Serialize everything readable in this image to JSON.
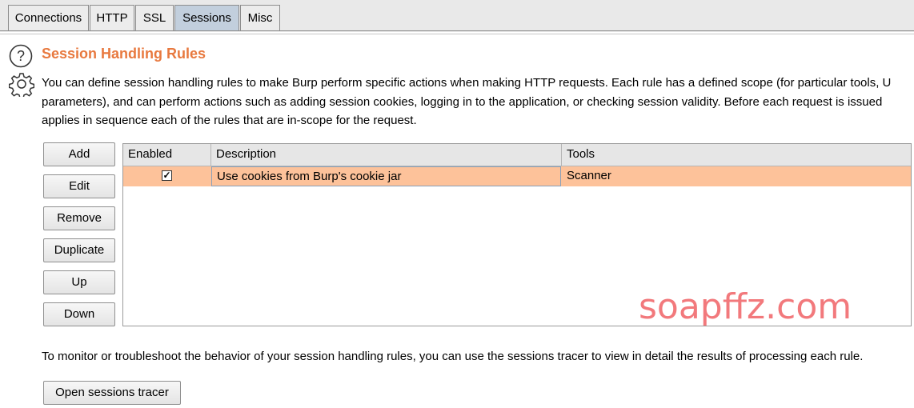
{
  "tabs": [
    {
      "label": "Connections",
      "active": false
    },
    {
      "label": "HTTP",
      "active": false
    },
    {
      "label": "SSL",
      "active": false
    },
    {
      "label": "Sessions",
      "active": true
    },
    {
      "label": "Misc",
      "active": false
    }
  ],
  "section": {
    "title": "Session Handling Rules",
    "description_lines": [
      "You can define session handling rules to make Burp perform specific actions when making HTTP requests. Each rule has a defined scope (for particular tools, U",
      "parameters), and can perform actions such as adding session cookies, logging in to the application, or checking session validity. Before each request is issued",
      "applies in sequence each of the rules that are in-scope for the request."
    ]
  },
  "buttons": {
    "add": "Add",
    "edit": "Edit",
    "remove": "Remove",
    "duplicate": "Duplicate",
    "up": "Up",
    "down": "Down",
    "open_tracer": "Open sessions tracer"
  },
  "rules_table": {
    "columns": [
      "Enabled",
      "Description",
      "Tools"
    ],
    "rows": [
      {
        "enabled": true,
        "enabled_glyph": "✓",
        "description": "Use cookies from Burp's cookie jar",
        "tools": "Scanner"
      }
    ]
  },
  "footer_text": "To monitor or troubleshoot the behavior of your session handling rules, you can use the sessions tracer to view in detail the results of processing each rule.",
  "watermark": "soapffz.com",
  "colors": {
    "title": "#e8793f",
    "selected_row": "#fdc29a",
    "active_tab": "#c2cfdd",
    "watermark": "#f2797c"
  }
}
